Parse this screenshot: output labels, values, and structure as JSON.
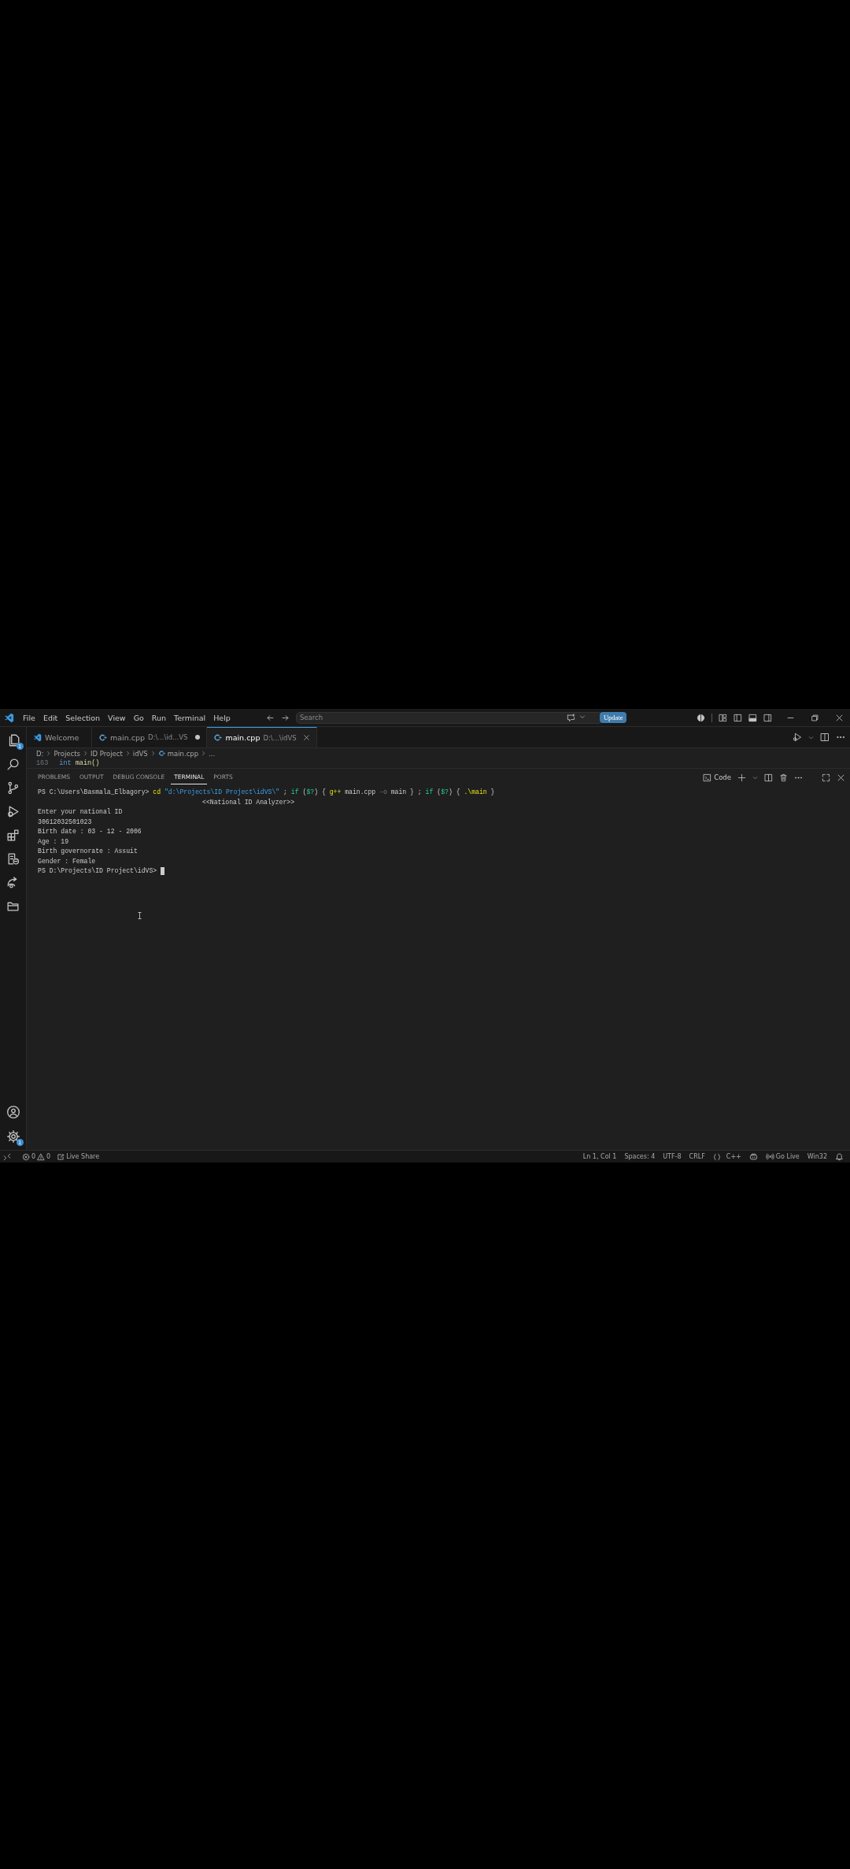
{
  "menu": [
    "File",
    "Edit",
    "Selection",
    "View",
    "Go",
    "Run",
    "Terminal",
    "Help"
  ],
  "search": {
    "placeholder": "Search"
  },
  "update_button": "Update",
  "activity_bar": {
    "explorer_badge": "1",
    "settings_badge": "1"
  },
  "tabs": [
    {
      "label": "Welcome",
      "kind": "welcome",
      "selected": false,
      "dirty": false
    },
    {
      "label": "main.cpp",
      "path": "D:\\...\\id...VS",
      "kind": "cpp",
      "selected": false,
      "dirty": true
    },
    {
      "label": "main.cpp",
      "path": "D:\\...\\idVS",
      "kind": "cpp",
      "selected": true,
      "dirty": false
    }
  ],
  "breadcrumb": [
    "D:",
    "Projects",
    "ID Project",
    "idVS",
    "main.cpp",
    "..."
  ],
  "code_line": {
    "number": "163",
    "keyword": "int",
    "function": "main()"
  },
  "panel_tabs": [
    {
      "label": "PROBLEMS",
      "selected": false
    },
    {
      "label": "OUTPUT",
      "selected": false
    },
    {
      "label": "DEBUG CONSOLE",
      "selected": false
    },
    {
      "label": "TERMINAL",
      "selected": true
    },
    {
      "label": "PORTS",
      "selected": false
    }
  ],
  "terminal_profile": "Code",
  "terminal_lines": [
    {
      "kind": "command",
      "segments": [
        {
          "kind": "plain",
          "text": "PS C:\\Users\\Basmala_Elbagory> "
        },
        {
          "kind": "cmd",
          "text": "cd"
        },
        {
          "kind": "string",
          "text": " \"d:\\Projects\\ID Project\\idVS\\\""
        },
        {
          "kind": "plain",
          "text": " ; "
        },
        {
          "kind": "keyword",
          "text": "if"
        },
        {
          "kind": "plain",
          "text": " ("
        },
        {
          "kind": "keyword",
          "text": "$?"
        },
        {
          "kind": "plain",
          "text": ") { "
        },
        {
          "kind": "cmd",
          "text": "g++"
        },
        {
          "kind": "plain",
          "text": " main.cpp "
        },
        {
          "kind": "param",
          "text": "-o"
        },
        {
          "kind": "plain",
          "text": " main } ; "
        },
        {
          "kind": "keyword",
          "text": "if"
        },
        {
          "kind": "plain",
          "text": " ("
        },
        {
          "kind": "keyword",
          "text": "$?"
        },
        {
          "kind": "plain",
          "text": ") { "
        },
        {
          "kind": "cmd",
          "text": ".\\main"
        },
        {
          "kind": "plain",
          "text": " }"
        }
      ]
    },
    {
      "kind": "banner",
      "text": "<<National ID Analyzer>>"
    },
    {
      "kind": "output",
      "text": "Enter your national ID"
    },
    {
      "kind": "output",
      "text": "30612032501023"
    },
    {
      "kind": "output",
      "text": "Birth date : 03 - 12 - 2006"
    },
    {
      "kind": "output",
      "text": "Age : 19"
    },
    {
      "kind": "output",
      "text": "Birth governorate : Assuit"
    },
    {
      "kind": "output",
      "text": "Gender : Female"
    },
    {
      "kind": "prompt",
      "text": "PS D:\\Projects\\ID Project\\idVS>"
    }
  ],
  "status_left": {
    "errors": "0",
    "warnings": "0",
    "live_share": "Live Share"
  },
  "status_right": [
    {
      "kind": "text",
      "text": "Ln 1, Col 1"
    },
    {
      "kind": "text",
      "text": "Spaces: 4"
    },
    {
      "kind": "text",
      "text": "UTF-8"
    },
    {
      "kind": "text",
      "text": "CRLF"
    },
    {
      "kind": "language",
      "text": "C++"
    },
    {
      "kind": "copilot"
    },
    {
      "kind": "golive",
      "text": "Go Live"
    },
    {
      "kind": "text",
      "text": "Win32"
    },
    {
      "kind": "bell"
    }
  ]
}
